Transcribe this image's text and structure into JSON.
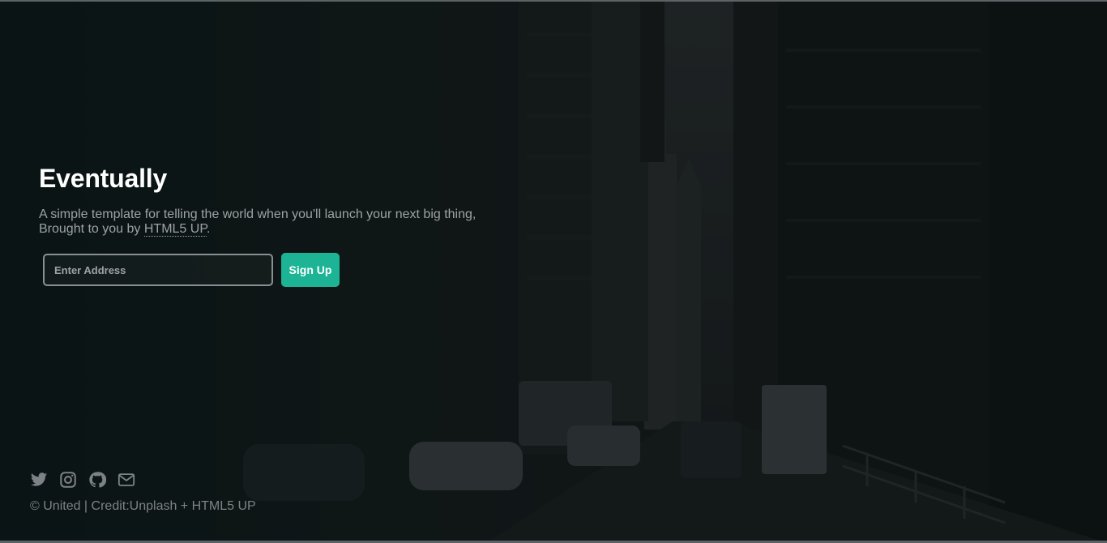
{
  "hero": {
    "title": "Eventually",
    "subtitle_line1": "A simple template for telling the world when you'll launch your next big thing,",
    "subtitle_prefix": "Brought to you by",
    "subtitle_link": "HTML5 UP",
    "subtitle_suffix": "."
  },
  "signup": {
    "placeholder": "Enter Address",
    "button_label": "Sign Up"
  },
  "footer": {
    "icons": [
      "twitter-icon",
      "instagram-icon",
      "github-icon",
      "envelope-icon"
    ],
    "copyright": "© United | Credit:Unplash + HTML5 UP"
  },
  "colors": {
    "accent": "#1cb495",
    "background": "#15181a",
    "text_muted": "#9ea2a5"
  }
}
